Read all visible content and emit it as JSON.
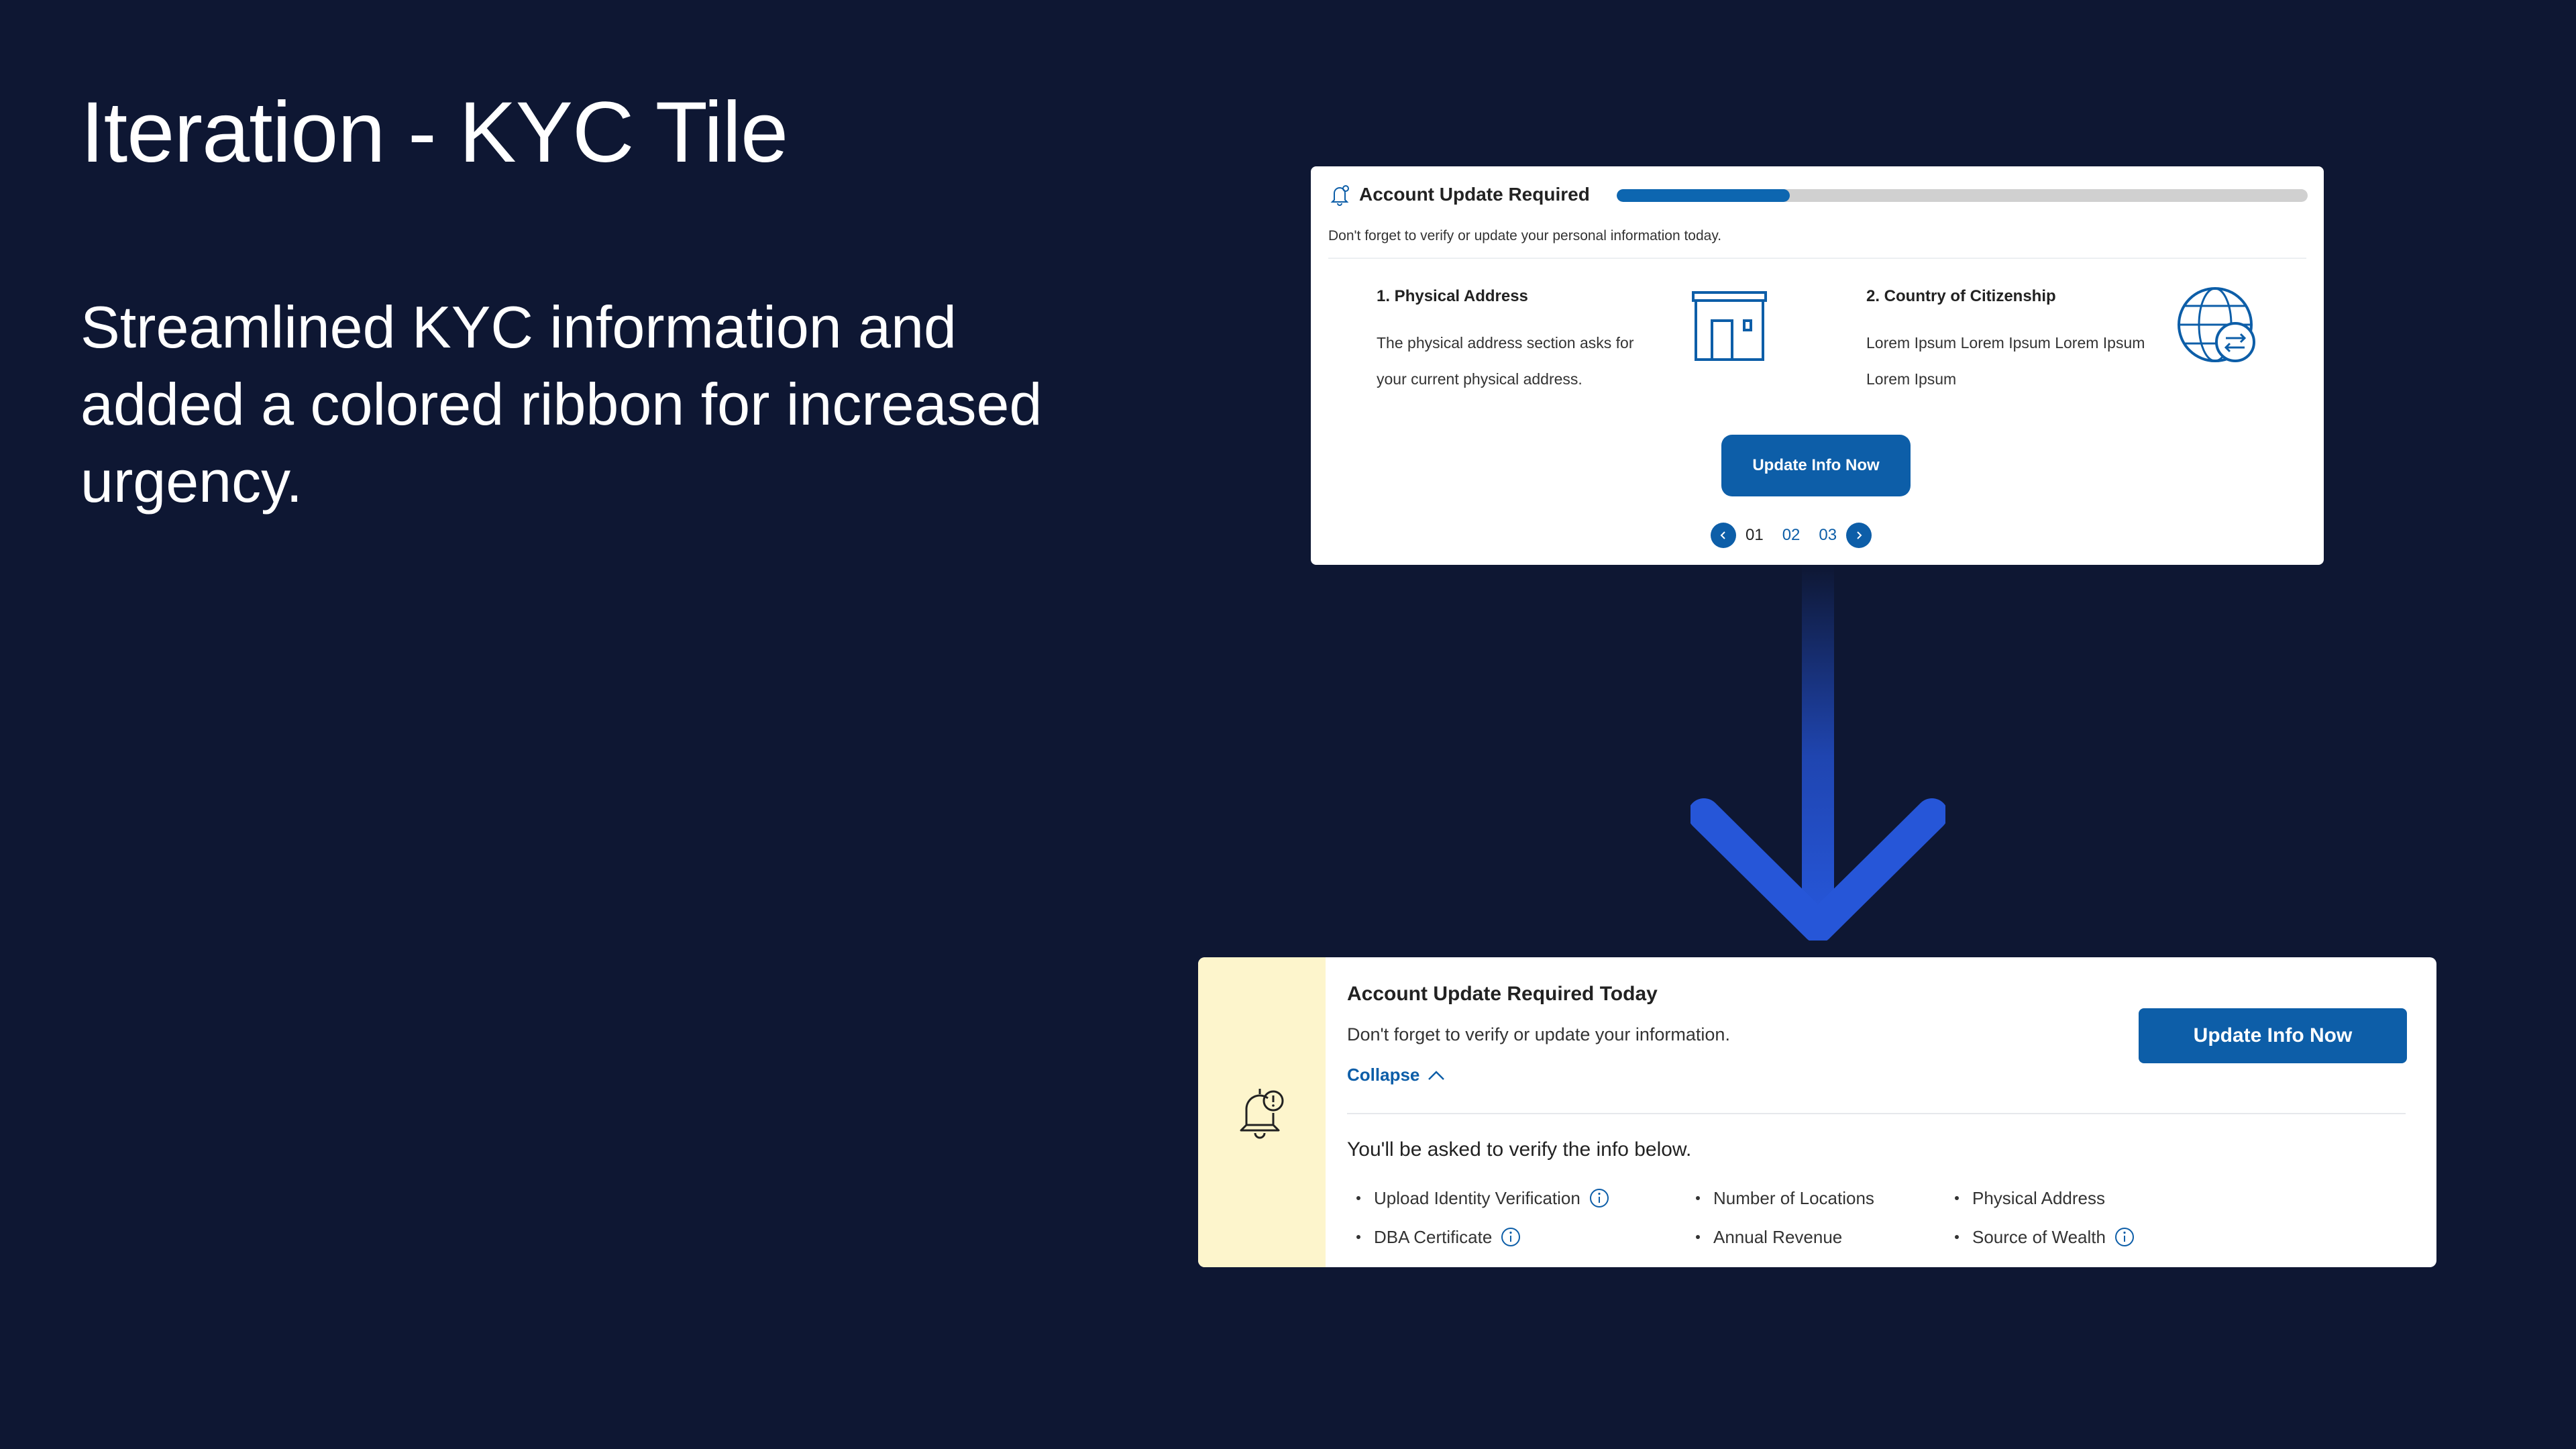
{
  "slide": {
    "title": "Iteration - KYC Tile",
    "description": "Streamlined KYC information and added a colored ribbon for increased urgency."
  },
  "old_tile": {
    "title": "Account Update Required",
    "progress": 0.25,
    "subtitle": "Don't forget to verify or update your personal information today.",
    "cards": [
      {
        "title": "1. Physical Address",
        "body": "The physical address section asks for your current physical address.",
        "icon": "building-icon"
      },
      {
        "title": "2. Country of Citizenship",
        "body": "Lorem Ipsum Lorem Ipsum Lorem Ipsum Lorem Ipsum",
        "icon": "globe-exchange-icon"
      }
    ],
    "button_label": "Update Info Now",
    "pager": {
      "pages": [
        "01",
        "02",
        "03"
      ],
      "active": "01"
    },
    "colors": {
      "primary": "#0d5ea8",
      "track": "#d0d0d0"
    }
  },
  "new_tile": {
    "title": "Account Update Required Today",
    "subtitle": "Don't forget to verify or update your information.",
    "collapse_label": "Collapse",
    "button_label": "Update Info Now",
    "verify_heading": "You'll be asked to verify the info below.",
    "columns": [
      [
        {
          "label": "Upload Identity Verification",
          "info": true
        },
        {
          "label": "DBA Certificate",
          "info": true
        }
      ],
      [
        {
          "label": "Number of Locations",
          "info": false
        },
        {
          "label": "Annual Revenue",
          "info": false
        }
      ],
      [
        {
          "label": "Physical Address",
          "info": false
        },
        {
          "label": "Source of Wealth",
          "info": true
        }
      ]
    ],
    "colors": {
      "ribbon": "#fdf5cc",
      "primary": "#0d5ea8"
    }
  },
  "colors": {
    "background": "#0e1733",
    "arrow": "#2656d8"
  }
}
